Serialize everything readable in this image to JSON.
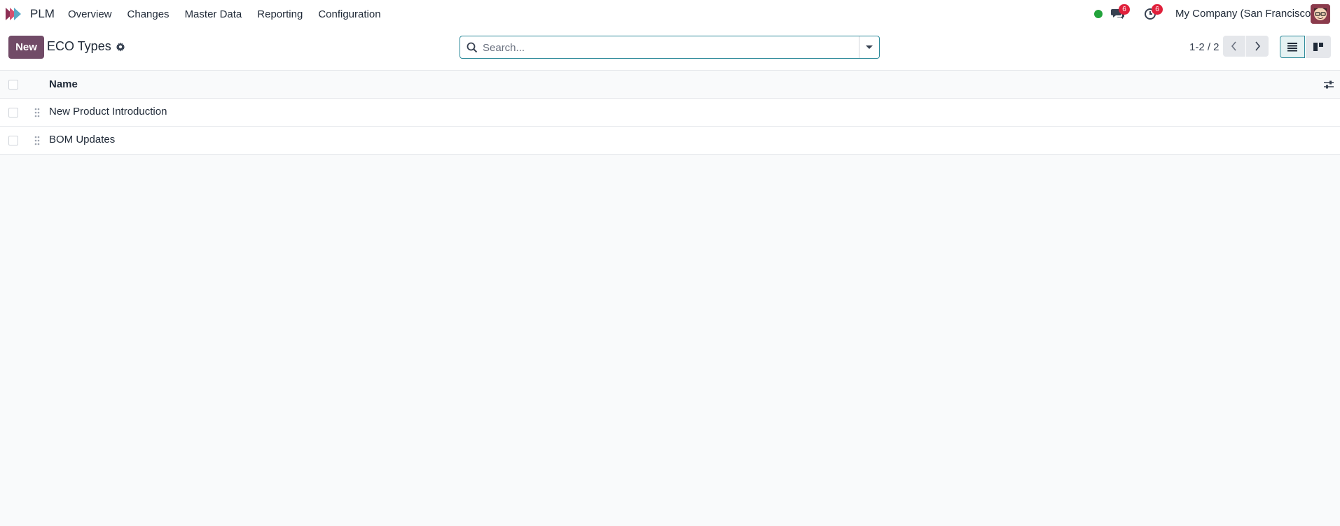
{
  "app": {
    "name": "PLM"
  },
  "menu": [
    {
      "label": "Overview"
    },
    {
      "label": "Changes"
    },
    {
      "label": "Master Data"
    },
    {
      "label": "Reporting"
    },
    {
      "label": "Configuration"
    }
  ],
  "systray": {
    "messages_count": "6",
    "activities_count": "6",
    "company": "My Company (San Francisco)",
    "status_color": "#22a33b"
  },
  "control": {
    "new_label": "New",
    "breadcrumb": "ECO Types",
    "search_placeholder": "Search...",
    "pager": "1-2 / 2"
  },
  "list": {
    "columns": [
      {
        "label": "Name"
      }
    ],
    "rows": [
      {
        "name": "New Product Introduction"
      },
      {
        "name": "BOM Updates"
      }
    ]
  },
  "colors": {
    "brand": "#714b67",
    "accent": "#2d8a9a",
    "badge": "#e0203b"
  }
}
